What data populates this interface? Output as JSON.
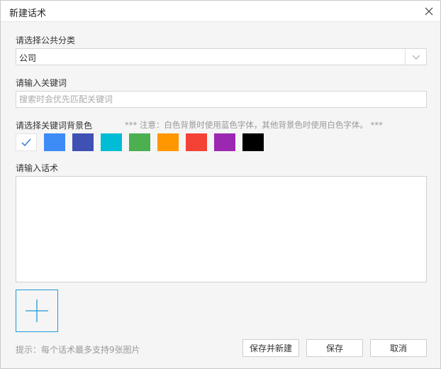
{
  "dialog": {
    "title": "新建话术",
    "close_icon": "close-icon"
  },
  "category": {
    "label": "请选择公共分类",
    "value": "公司",
    "arrow_icon": "chevron-down-icon"
  },
  "keyword": {
    "label": "请输入关键词",
    "placeholder": "搜索时会优先匹配关键词",
    "value": ""
  },
  "color": {
    "label": "请选择关键词背景色",
    "note": "*** 注意：白色背景时使用蓝色字体，其他背景色时使用白色字体。 ***",
    "selected": "#ffffff",
    "check_icon": "check-icon",
    "swatches": [
      "#ffffff",
      "#3d8bf5",
      "#3f51b5",
      "#00bcd4",
      "#4caf50",
      "#ff9800",
      "#f44336",
      "#9c27b0",
      "#000000"
    ]
  },
  "script": {
    "label": "请输入话术",
    "value": ""
  },
  "image": {
    "add_icon": "plus-icon",
    "hint": "提示：每个话术最多支持9张图片"
  },
  "buttons": {
    "save_new": "保存并新建",
    "save": "保存",
    "cancel": "取消"
  }
}
